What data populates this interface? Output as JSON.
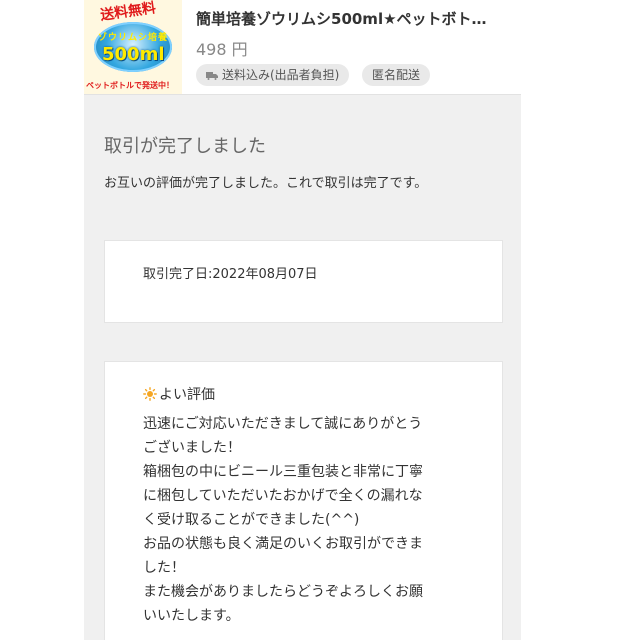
{
  "item": {
    "thumb_text_top": "送料無料",
    "thumb_text_mid": "ゾウリムシ培養",
    "thumb_text_big": "500ml",
    "thumb_text_bottom": "ペットボトルで発送中！",
    "title": "簡単培養ゾウリムシ500ml★ペットボト…",
    "price": "498 円",
    "chips": [
      {
        "label": "送料込み(出品者負担)",
        "icon": "truck-icon"
      },
      {
        "label": "匿名配送"
      }
    ]
  },
  "transaction": {
    "heading": "取引が完了しました",
    "message": "お互いの評価が完了しました。これで取引は完了です。",
    "completed_date": "取引完了日:2022年08月07日"
  },
  "review": {
    "icon": "sun-icon",
    "icon_color": "#f5a623",
    "rating_label": "よい評価",
    "body": "迅速にご対応いただきまして誠にありがとう\nございました！\n箱梱包の中にビニール三重包装と非常に丁寧\nに梱包していただいたおかげで全くの漏れな\nく受け取ることができました(^^)\nお品の状態も良く満足のいくお取引ができま\nした！\nまた機会がありましたらどうぞよろしくお願\nいいたします。"
  }
}
